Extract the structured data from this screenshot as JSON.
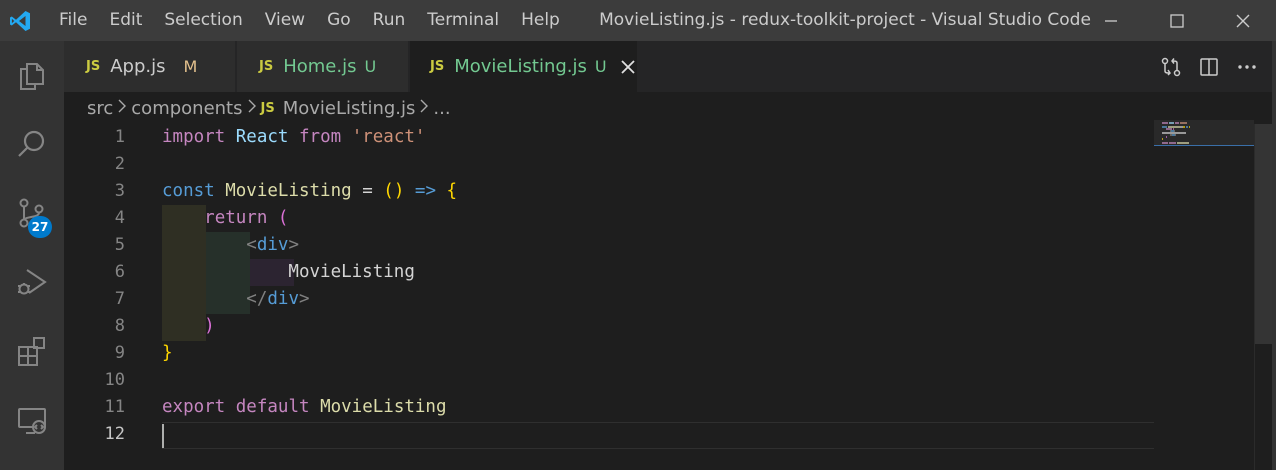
{
  "titlebar": {
    "menu": [
      "File",
      "Edit",
      "Selection",
      "View",
      "Go",
      "Run",
      "Terminal",
      "Help"
    ],
    "window_title": "MovieListing.js - redux-toolkit-project - Visual Studio Code",
    "controls": [
      "minimize-icon",
      "maximize-icon",
      "close-icon"
    ]
  },
  "activitybar": {
    "items": [
      "explorer-icon",
      "search-icon",
      "source-control-icon",
      "run-debug-icon",
      "extensions-icon",
      "remote-explorer-icon"
    ],
    "source_control_badge": "27"
  },
  "tabs": [
    {
      "icon": "JS",
      "label": "App.js",
      "status": "M",
      "active": false,
      "color": "#cccccc",
      "status_color": "#e2c08d"
    },
    {
      "icon": "JS",
      "label": "Home.js",
      "status": "U",
      "active": false,
      "color": "#73c991",
      "status_color": "#73c991"
    },
    {
      "icon": "JS",
      "label": "MovieListing.js",
      "status": "U",
      "active": true,
      "color": "#73c991",
      "status_color": "#73c991"
    }
  ],
  "editor_actions": [
    "open-changes-icon",
    "split-editor-icon",
    "more-actions-icon"
  ],
  "breadcrumb": {
    "parts": [
      "src",
      "components"
    ],
    "file_icon": "JS",
    "file": "MovieListing.js",
    "tail": "..."
  },
  "editor": {
    "current_line": 12,
    "lines": [
      {
        "num": "1",
        "tokens": [
          [
            "kw",
            "import"
          ],
          [
            "txt",
            " "
          ],
          [
            "var",
            "React"
          ],
          [
            "txt",
            " "
          ],
          [
            "kw",
            "from"
          ],
          [
            "txt",
            " "
          ],
          [
            "str",
            "'react'"
          ]
        ]
      },
      {
        "num": "2",
        "tokens": []
      },
      {
        "num": "3",
        "tokens": [
          [
            "kw2",
            "const"
          ],
          [
            "txt",
            " "
          ],
          [
            "fn",
            "MovieListing"
          ],
          [
            "txt",
            " = "
          ],
          [
            "brace",
            "()"
          ],
          [
            "txt",
            " "
          ],
          [
            "kw2",
            "=>"
          ],
          [
            "txt",
            " "
          ],
          [
            "brace",
            "{"
          ]
        ]
      },
      {
        "num": "4",
        "tokens": [
          [
            "txt",
            "    "
          ],
          [
            "kw",
            "return"
          ],
          [
            "txt",
            " "
          ],
          [
            "paren",
            "("
          ]
        ]
      },
      {
        "num": "5",
        "tokens": [
          [
            "txt",
            "        "
          ],
          [
            "punct",
            "<"
          ],
          [
            "tag",
            "div"
          ],
          [
            "punct",
            ">"
          ]
        ]
      },
      {
        "num": "6",
        "tokens": [
          [
            "txt",
            "            MovieListing"
          ]
        ]
      },
      {
        "num": "7",
        "tokens": [
          [
            "txt",
            "        "
          ],
          [
            "punct",
            "</"
          ],
          [
            "tag",
            "div"
          ],
          [
            "punct",
            ">"
          ]
        ]
      },
      {
        "num": "8",
        "tokens": [
          [
            "txt",
            "    "
          ],
          [
            "paren",
            ")"
          ]
        ]
      },
      {
        "num": "9",
        "tokens": [
          [
            "brace",
            "}"
          ]
        ]
      },
      {
        "num": "10",
        "tokens": []
      },
      {
        "num": "11",
        "tokens": [
          [
            "kw",
            "export"
          ],
          [
            "txt",
            " "
          ],
          [
            "kw",
            "default"
          ],
          [
            "txt",
            " "
          ],
          [
            "fn",
            "MovieListing"
          ]
        ]
      },
      {
        "num": "12",
        "tokens": []
      }
    ]
  },
  "colors": {
    "titlebar": "#3c3c3c",
    "activitybar": "#333333",
    "editor_bg": "#1e1e1e",
    "badge": "#007acc",
    "accent_logo": "#23a9f2"
  }
}
